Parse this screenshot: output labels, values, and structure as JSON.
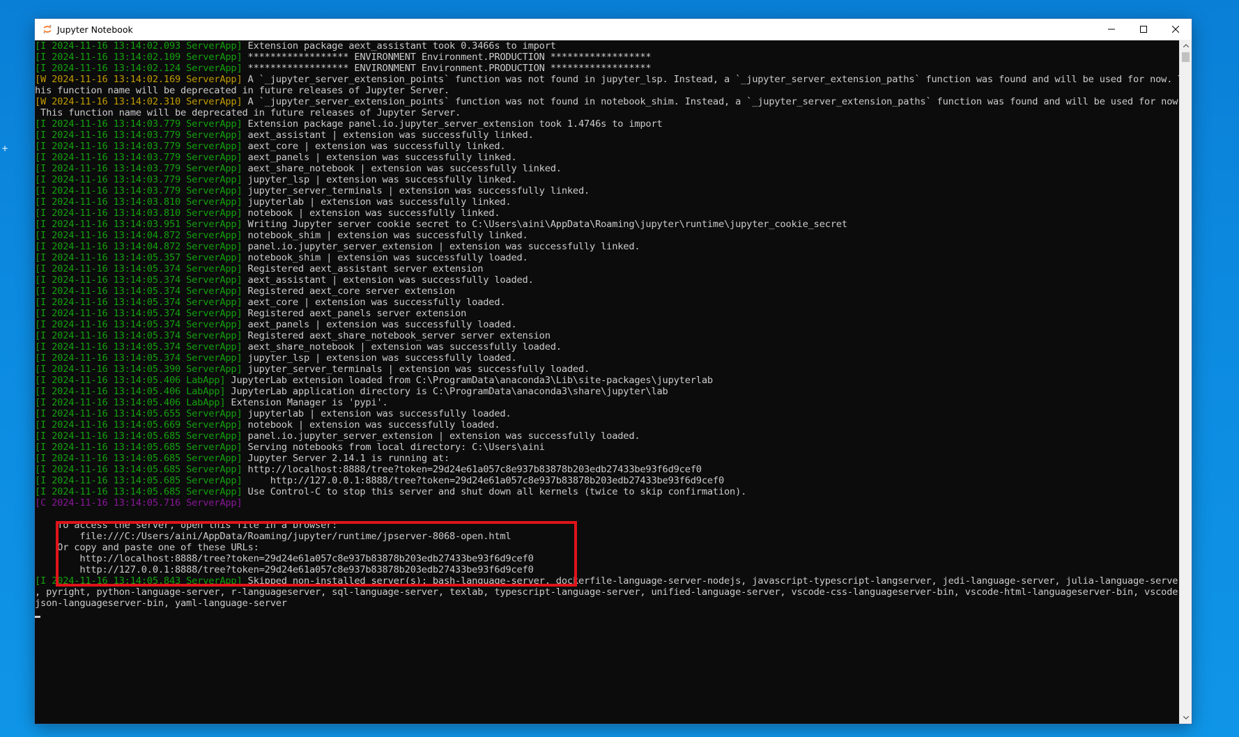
{
  "window": {
    "title": "Jupyter Notebook"
  },
  "console": {
    "lines": [
      {
        "prefix": "[I 2024-11-16 13:14:02.093 ServerApp]",
        "level": "I",
        "text": " Extension package aext_assistant took 0.3466s to import"
      },
      {
        "prefix": "[I 2024-11-16 13:14:02.109 ServerApp]",
        "level": "I",
        "text": " ****************** ENVIRONMENT Environment.PRODUCTION ******************"
      },
      {
        "prefix": "[I 2024-11-16 13:14:02.124 ServerApp]",
        "level": "I",
        "text": " ****************** ENVIRONMENT Environment.PRODUCTION ******************"
      },
      {
        "prefix": "[W 2024-11-16 13:14:02.169 ServerApp]",
        "level": "W",
        "text": " A `_jupyter_server_extension_points` function was not found in jupyter_lsp. Instead, a `_jupyter_server_extension_paths` function was found and will be used for now. T"
      },
      {
        "prefix": "",
        "level": "",
        "text": "his function name will be deprecated in future releases of Jupyter Server."
      },
      {
        "prefix": "[W 2024-11-16 13:14:02.310 ServerApp]",
        "level": "W",
        "text": " A `_jupyter_server_extension_points` function was not found in notebook_shim. Instead, a `_jupyter_server_extension_paths` function was found and will be used for now."
      },
      {
        "prefix": "",
        "level": "",
        "text": " This function name will be deprecated in future releases of Jupyter Server."
      },
      {
        "prefix": "[I 2024-11-16 13:14:03.779 ServerApp]",
        "level": "I",
        "text": " Extension package panel.io.jupyter_server_extension took 1.4746s to import"
      },
      {
        "prefix": "[I 2024-11-16 13:14:03.779 ServerApp]",
        "level": "I",
        "text": " aext_assistant | extension was successfully linked."
      },
      {
        "prefix": "[I 2024-11-16 13:14:03.779 ServerApp]",
        "level": "I",
        "text": " aext_core | extension was successfully linked."
      },
      {
        "prefix": "[I 2024-11-16 13:14:03.779 ServerApp]",
        "level": "I",
        "text": " aext_panels | extension was successfully linked."
      },
      {
        "prefix": "[I 2024-11-16 13:14:03.779 ServerApp]",
        "level": "I",
        "text": " aext_share_notebook | extension was successfully linked."
      },
      {
        "prefix": "[I 2024-11-16 13:14:03.779 ServerApp]",
        "level": "I",
        "text": " jupyter_lsp | extension was successfully linked."
      },
      {
        "prefix": "[I 2024-11-16 13:14:03.779 ServerApp]",
        "level": "I",
        "text": " jupyter_server_terminals | extension was successfully linked."
      },
      {
        "prefix": "[I 2024-11-16 13:14:03.810 ServerApp]",
        "level": "I",
        "text": " jupyterlab | extension was successfully linked."
      },
      {
        "prefix": "[I 2024-11-16 13:14:03.810 ServerApp]",
        "level": "I",
        "text": " notebook | extension was successfully linked."
      },
      {
        "prefix": "[I 2024-11-16 13:14:03.951 ServerApp]",
        "level": "I",
        "text": " Writing Jupyter server cookie secret to C:\\Users\\aini\\AppData\\Roaming\\jupyter\\runtime\\jupyter_cookie_secret"
      },
      {
        "prefix": "[I 2024-11-16 13:14:04.872 ServerApp]",
        "level": "I",
        "text": " notebook_shim | extension was successfully linked."
      },
      {
        "prefix": "[I 2024-11-16 13:14:04.872 ServerApp]",
        "level": "I",
        "text": " panel.io.jupyter_server_extension | extension was successfully linked."
      },
      {
        "prefix": "[I 2024-11-16 13:14:05.357 ServerApp]",
        "level": "I",
        "text": " notebook_shim | extension was successfully loaded."
      },
      {
        "prefix": "[I 2024-11-16 13:14:05.374 ServerApp]",
        "level": "I",
        "text": " Registered aext_assistant server extension"
      },
      {
        "prefix": "[I 2024-11-16 13:14:05.374 ServerApp]",
        "level": "I",
        "text": " aext_assistant | extension was successfully loaded."
      },
      {
        "prefix": "[I 2024-11-16 13:14:05.374 ServerApp]",
        "level": "I",
        "text": " Registered aext_core server extension"
      },
      {
        "prefix": "[I 2024-11-16 13:14:05.374 ServerApp]",
        "level": "I",
        "text": " aext_core | extension was successfully loaded."
      },
      {
        "prefix": "[I 2024-11-16 13:14:05.374 ServerApp]",
        "level": "I",
        "text": " Registered aext_panels server extension"
      },
      {
        "prefix": "[I 2024-11-16 13:14:05.374 ServerApp]",
        "level": "I",
        "text": " aext_panels | extension was successfully loaded."
      },
      {
        "prefix": "[I 2024-11-16 13:14:05.374 ServerApp]",
        "level": "I",
        "text": " Registered aext_share_notebook_server server extension"
      },
      {
        "prefix": "[I 2024-11-16 13:14:05.374 ServerApp]",
        "level": "I",
        "text": " aext_share_notebook | extension was successfully loaded."
      },
      {
        "prefix": "[I 2024-11-16 13:14:05.374 ServerApp]",
        "level": "I",
        "text": " jupyter_lsp | extension was successfully loaded."
      },
      {
        "prefix": "[I 2024-11-16 13:14:05.390 ServerApp]",
        "level": "I",
        "text": " jupyter_server_terminals | extension was successfully loaded."
      },
      {
        "prefix": "[I 2024-11-16 13:14:05.406 LabApp]",
        "level": "I",
        "text": " JupyterLab extension loaded from C:\\ProgramData\\anaconda3\\Lib\\site-packages\\jupyterlab"
      },
      {
        "prefix": "[I 2024-11-16 13:14:05.406 LabApp]",
        "level": "I",
        "text": " JupyterLab application directory is C:\\ProgramData\\anaconda3\\share\\jupyter\\lab"
      },
      {
        "prefix": "[I 2024-11-16 13:14:05.406 LabApp]",
        "level": "I",
        "text": " Extension Manager is 'pypi'."
      },
      {
        "prefix": "[I 2024-11-16 13:14:05.655 ServerApp]",
        "level": "I",
        "text": " jupyterlab | extension was successfully loaded."
      },
      {
        "prefix": "[I 2024-11-16 13:14:05.669 ServerApp]",
        "level": "I",
        "text": " notebook | extension was successfully loaded."
      },
      {
        "prefix": "[I 2024-11-16 13:14:05.685 ServerApp]",
        "level": "I",
        "text": " panel.io.jupyter_server_extension | extension was successfully loaded."
      },
      {
        "prefix": "[I 2024-11-16 13:14:05.685 ServerApp]",
        "level": "I",
        "text": " Serving notebooks from local directory: C:\\Users\\aini"
      },
      {
        "prefix": "[I 2024-11-16 13:14:05.685 ServerApp]",
        "level": "I",
        "text": " Jupyter Server 2.14.1 is running at:"
      },
      {
        "prefix": "[I 2024-11-16 13:14:05.685 ServerApp]",
        "level": "I",
        "text": " http://localhost:8888/tree?token=29d24e61a057c8e937b83878b203edb27433be93f6d9cef0"
      },
      {
        "prefix": "[I 2024-11-16 13:14:05.685 ServerApp]",
        "level": "I",
        "text": "     http://127.0.0.1:8888/tree?token=29d24e61a057c8e937b83878b203edb27433be93f6d9cef0"
      },
      {
        "prefix": "[I 2024-11-16 13:14:05.685 ServerApp]",
        "level": "I",
        "text": " Use Control-C to stop this server and shut down all kernels (twice to skip confirmation)."
      },
      {
        "prefix": "[C 2024-11-16 13:14:05.716 ServerApp]",
        "level": "C",
        "text": ""
      },
      {
        "prefix": "",
        "level": "",
        "text": ""
      },
      {
        "prefix": "",
        "level": "",
        "text": "    To access the server, open this file in a browser:"
      },
      {
        "prefix": "",
        "level": "",
        "text": "        file:///C:/Users/aini/AppData/Roaming/jupyter/runtime/jpserver-8068-open.html"
      },
      {
        "prefix": "",
        "level": "",
        "text": "    Or copy and paste one of these URLs:"
      },
      {
        "prefix": "",
        "level": "",
        "text": "        http://localhost:8888/tree?token=29d24e61a057c8e937b83878b203edb27433be93f6d9cef0"
      },
      {
        "prefix": "",
        "level": "",
        "text": "        http://127.0.0.1:8888/tree?token=29d24e61a057c8e937b83878b203edb27433be93f6d9cef0"
      },
      {
        "prefix": "[I 2024-11-16 13:14:05.843 ServerApp]",
        "level": "I",
        "text": " Skipped non-installed server(s): bash-language-server, dockerfile-language-server-nodejs, javascript-typescript-langserver, jedi-language-server, julia-language-server"
      },
      {
        "prefix": "",
        "level": "",
        "text": ", pyright, python-language-server, r-languageserver, sql-language-server, texlab, typescript-language-server, unified-language-server, vscode-css-languageserver-bin, vscode-html-languageserver-bin, vscode-"
      },
      {
        "prefix": "",
        "level": "",
        "text": "json-languageserver-bin, yaml-language-server"
      }
    ]
  },
  "colors": {
    "info": "#13a10e",
    "warning": "#c19c00",
    "critical": "#881798",
    "text": "#cccccc",
    "background": "#0c0c0c",
    "highlight": "#e0141a"
  },
  "icons": {
    "app": "jupyter-icon",
    "minimize": "minimize-icon",
    "maximize": "maximize-icon",
    "close": "close-icon",
    "scroll_up": "chevron-up-icon",
    "scroll_down": "chevron-down-icon"
  }
}
